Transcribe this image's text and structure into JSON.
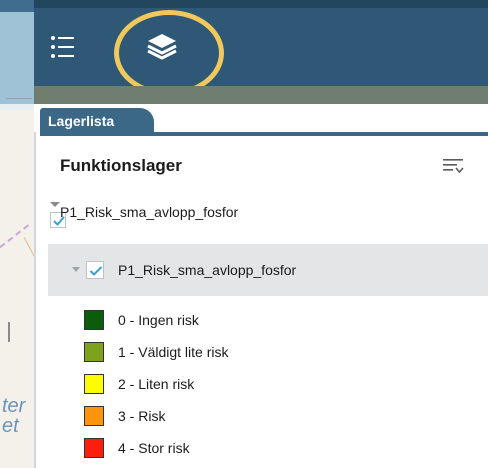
{
  "toolbar": {
    "list_icon": "list-icon",
    "layers_icon": "layers-icon",
    "highlight_color": "#f1c85c",
    "background_color": "#2f5876"
  },
  "map": {
    "label_lines": [
      "ter",
      "et"
    ]
  },
  "panel": {
    "tab_label": "Lagerlista",
    "title": "Funktionslager",
    "filter_icon": "filter-icon",
    "accent_color": "#3c6888",
    "group": {
      "label": "P1_Risk_sma_avlopp_fosfor",
      "checked": true
    },
    "sublayer": {
      "label": "P1_Risk_sma_avlopp_fosfor",
      "checked": true
    },
    "legend": [
      {
        "label": "0 - Ingen risk",
        "color": "#0b5c0b"
      },
      {
        "label": "1 - Väldigt lite risk",
        "color": "#7ea21c"
      },
      {
        "label": "2 - Liten risk",
        "color": "#fdfd00"
      },
      {
        "label": "3 - Risk",
        "color": "#fc950c"
      },
      {
        "label": "4 - Stor risk",
        "color": "#fc1e0c"
      }
    ]
  }
}
